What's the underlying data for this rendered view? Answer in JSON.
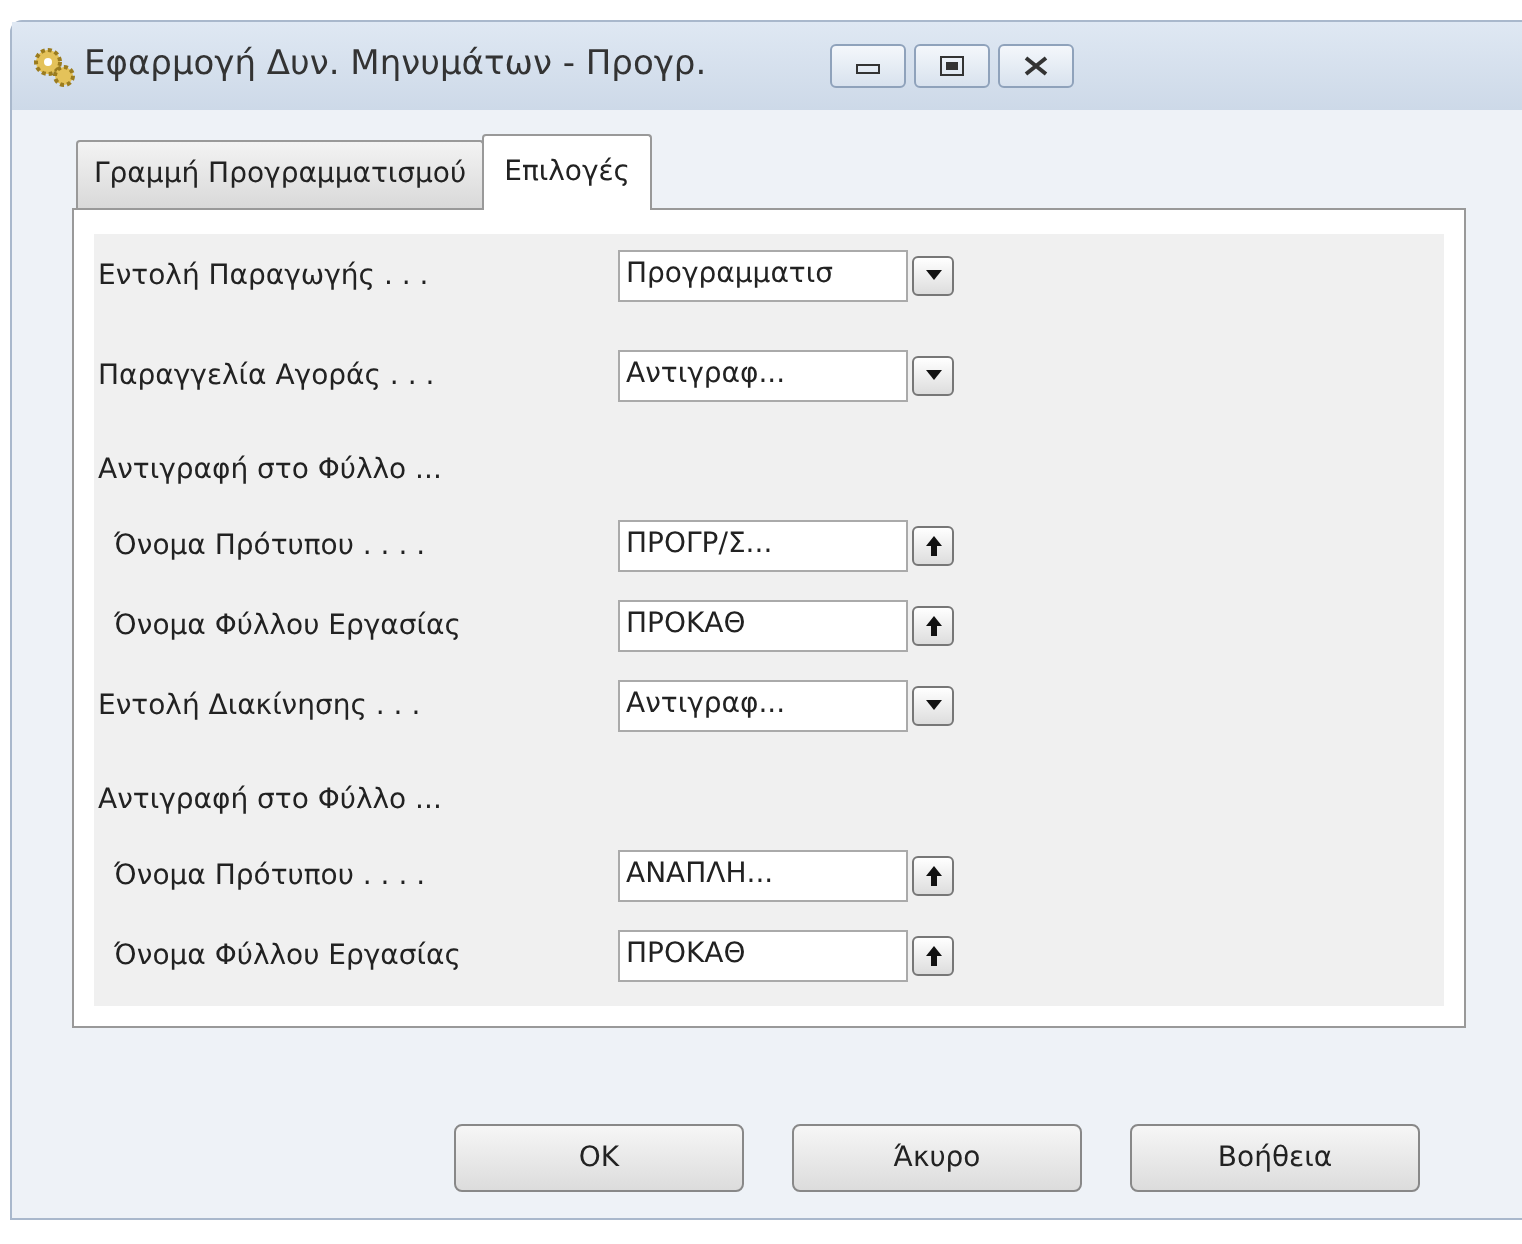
{
  "window": {
    "title": "Εφαρμογή Δυν. Μηνυμάτων - Προγρ."
  },
  "tabs": [
    {
      "label": "Γραμμή Προγραμματισμού",
      "selected": false
    },
    {
      "label": "Επιλογές",
      "selected": true
    }
  ],
  "fields": [
    {
      "kind": "dropdown",
      "label": "Εντολή Παραγωγής . . .",
      "value": "Προγραμματισ"
    },
    {
      "kind": "dropdown",
      "label": "Παραγγελία Αγοράς . . .",
      "value": "Αντιγραφ..."
    },
    {
      "kind": "heading",
      "label": "Αντιγραφή στο Φύλλο ...",
      "children": [
        {
          "kind": "lookup",
          "label": "Όνομα Πρότυπου . . . .",
          "value": "ΠΡΟΓΡ/Σ..."
        },
        {
          "kind": "lookup",
          "label": "Όνομα Φύλλου Εργασίας",
          "value": "ΠΡΟΚΑΘ"
        }
      ]
    },
    {
      "kind": "dropdown",
      "label": "Εντολή Διακίνησης . . .",
      "value": "Αντιγραφ..."
    },
    {
      "kind": "heading",
      "label": "Αντιγραφή στο Φύλλο ...",
      "children": [
        {
          "kind": "lookup",
          "label": "Όνομα Πρότυπου . . . .",
          "value": "ΑΝΑΠΛΗ..."
        },
        {
          "kind": "lookup",
          "label": "Όνομα Φύλλου Εργασίας",
          "value": "ΠΡΟΚΑΘ"
        }
      ]
    }
  ],
  "buttons": [
    "OK",
    "Άκυρο",
    "Βοήθεια"
  ]
}
